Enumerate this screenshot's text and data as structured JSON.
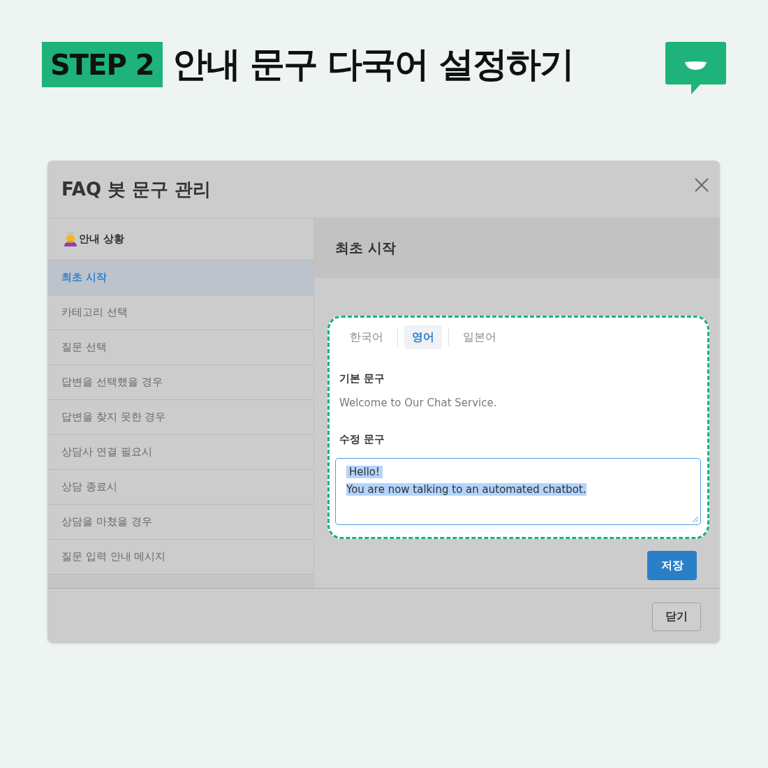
{
  "header": {
    "step_badge": "STEP 2",
    "title": "안내 문구 다국어 설정하기"
  },
  "dialog": {
    "title": "FAQ 봇 문구 관리"
  },
  "sidebar": {
    "heading": "안내 상황",
    "items": [
      {
        "label": "최초 시작",
        "selected": true
      },
      {
        "label": "카테고리 선택",
        "selected": false
      },
      {
        "label": "질문 선택",
        "selected": false
      },
      {
        "label": "답변을 선택했을 경우",
        "selected": false
      },
      {
        "label": "답변을 찾지 못한 경우",
        "selected": false
      },
      {
        "label": "상담사 연결 필요시",
        "selected": false
      },
      {
        "label": "상담 종료시",
        "selected": false
      },
      {
        "label": "상담을 마쳤을 경우",
        "selected": false
      },
      {
        "label": "질문 입력 안내 메시지",
        "selected": false
      }
    ]
  },
  "panel": {
    "title": "최초 시작",
    "language_tabs": [
      {
        "label": "한국어",
        "selected": false
      },
      {
        "label": "영어",
        "selected": true
      },
      {
        "label": "일본어",
        "selected": false
      }
    ],
    "default_label": "기본 문구",
    "default_text": "Welcome to Our Chat Service.",
    "edit_label": "수정 문구",
    "edit_lines": [
      "Hello!",
      "You are now talking to an automated chatbot."
    ],
    "edit_highlighted": true,
    "save_button": "저장"
  },
  "footer": {
    "close_button": "닫기"
  }
}
